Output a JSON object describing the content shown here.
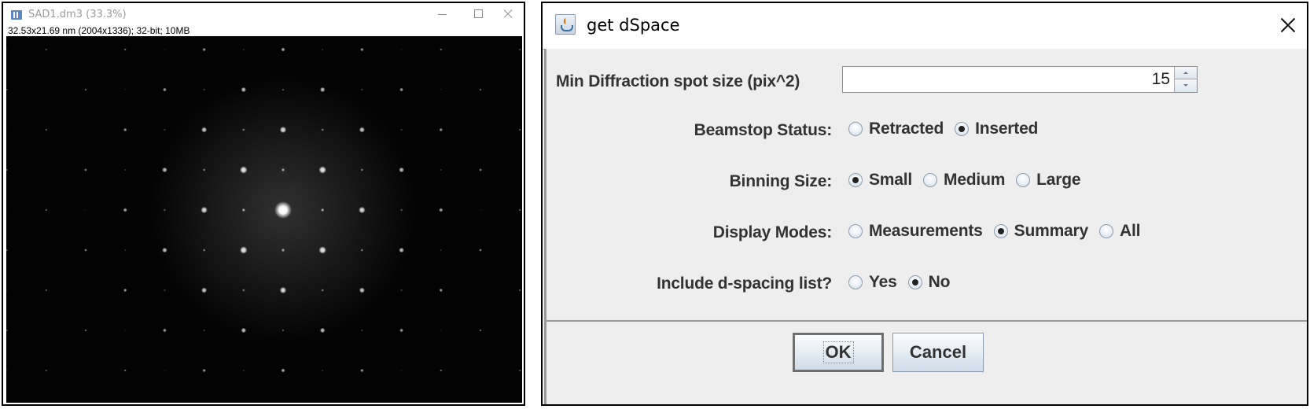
{
  "image_window": {
    "title": "SAD1.dm3 (33.3%)",
    "info": "32.53x21.69 nm (2004x1336); 32-bit; 10MB",
    "icons": {
      "app": "imagej-icon",
      "minimize": "minimize-icon",
      "maximize": "maximize-icon",
      "close": "close-icon"
    },
    "pattern": {
      "description": "Selected area electron diffraction pattern",
      "lattice_rows": 9,
      "lattice_cols": 12,
      "center_spot": {
        "row": 4,
        "col": 6
      }
    }
  },
  "dialog": {
    "title": "get dSpace",
    "icon": "java-cup-icon",
    "close_icon": "close-icon",
    "fields": {
      "min_spot_size": {
        "label": "Min Diffraction spot size (pix^2)",
        "value": "15"
      }
    },
    "radio_groups": [
      {
        "label": "Beamstop Status:",
        "options": [
          "Retracted",
          "Inserted"
        ],
        "selected": "Inserted"
      },
      {
        "label": "Binning Size:",
        "options": [
          "Small",
          "Medium",
          "Large"
        ],
        "selected": "Small"
      },
      {
        "label": "Display Modes:",
        "options": [
          "Measurements",
          "Summary",
          "All"
        ],
        "selected": "Summary"
      },
      {
        "label": "Include d-spacing list?",
        "options": [
          "Yes",
          "No"
        ],
        "selected": "No"
      }
    ],
    "buttons": {
      "ok": "OK",
      "cancel": "Cancel"
    }
  }
}
